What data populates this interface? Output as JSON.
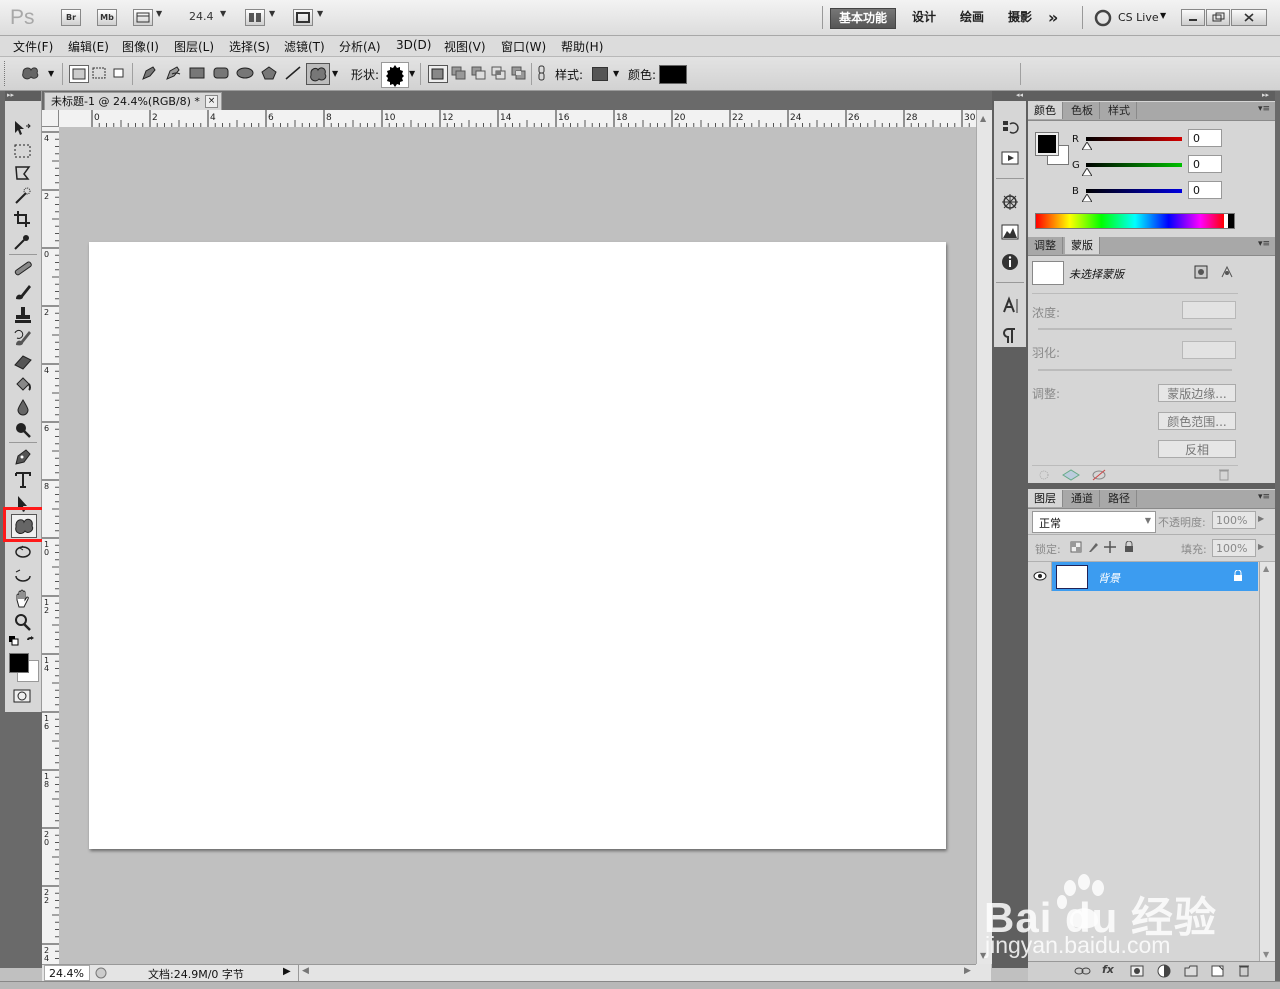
{
  "titlebar": {
    "app_logo": "Ps",
    "bridge_btn": "Br",
    "minibridge_btn": "Mb",
    "zoom": "24.4",
    "workspaces": [
      "基本功能",
      "设计",
      "绘画",
      "摄影"
    ],
    "more": "»",
    "cslive": "CS Live"
  },
  "menu": [
    "文件(F)",
    "编辑(E)",
    "图像(I)",
    "图层(L)",
    "选择(S)",
    "滤镜(T)",
    "分析(A)",
    "3D(D)",
    "视图(V)",
    "窗口(W)",
    "帮助(H)"
  ],
  "options": {
    "shape_label": "形状:",
    "style_label": "样式:",
    "color_label": "颜色:",
    "color_value": "#000000"
  },
  "document": {
    "tab_title": "未标题-1 @ 24.4%(RGB/8) *",
    "close": "×",
    "hruler_ticks": [
      "0",
      "2",
      "4",
      "6",
      "8",
      "10",
      "12",
      "14",
      "16",
      "18",
      "20",
      "22",
      "24",
      "26",
      "28",
      "30"
    ],
    "vruler_ticks": [
      "4",
      "2",
      "0",
      "2",
      "4",
      "6",
      "8",
      "1 0",
      "1 2",
      "1 4",
      "1 6",
      "1 8",
      "2 0",
      "2 2",
      "2 4"
    ],
    "status_zoom": "24.4%",
    "status_doc": "文档:24.9M/0 字节"
  },
  "panels": {
    "color": {
      "tabs": [
        "颜色",
        "色板",
        "样式"
      ],
      "channels": [
        {
          "label": "R",
          "value": "0",
          "color": "#d40000"
        },
        {
          "label": "G",
          "value": "0",
          "color": "#00c000"
        },
        {
          "label": "B",
          "value": "0",
          "color": "#0000e0"
        }
      ]
    },
    "masks": {
      "tabs": [
        "调整",
        "蒙版"
      ],
      "title": "未选择蒙版",
      "density_label": "浓度:",
      "feather_label": "羽化:",
      "adjust_label": "调整:",
      "buttons": [
        "蒙版边缘...",
        "颜色范围...",
        "反相"
      ]
    },
    "layers": {
      "tabs": [
        "图层",
        "通道",
        "路径"
      ],
      "blend_mode": "正常",
      "opacity_label": "不透明度:",
      "opacity_value": "100%",
      "lock_label": "锁定:",
      "fill_label": "填充:",
      "fill_value": "100%",
      "layer_name": "背景",
      "selected_color": "#3c9cf0"
    }
  },
  "annotation": {
    "highlight_color": "#ff1a1a"
  },
  "watermark": {
    "logo_text": "Bai du 经验",
    "url": "jingyan.baidu.com"
  }
}
